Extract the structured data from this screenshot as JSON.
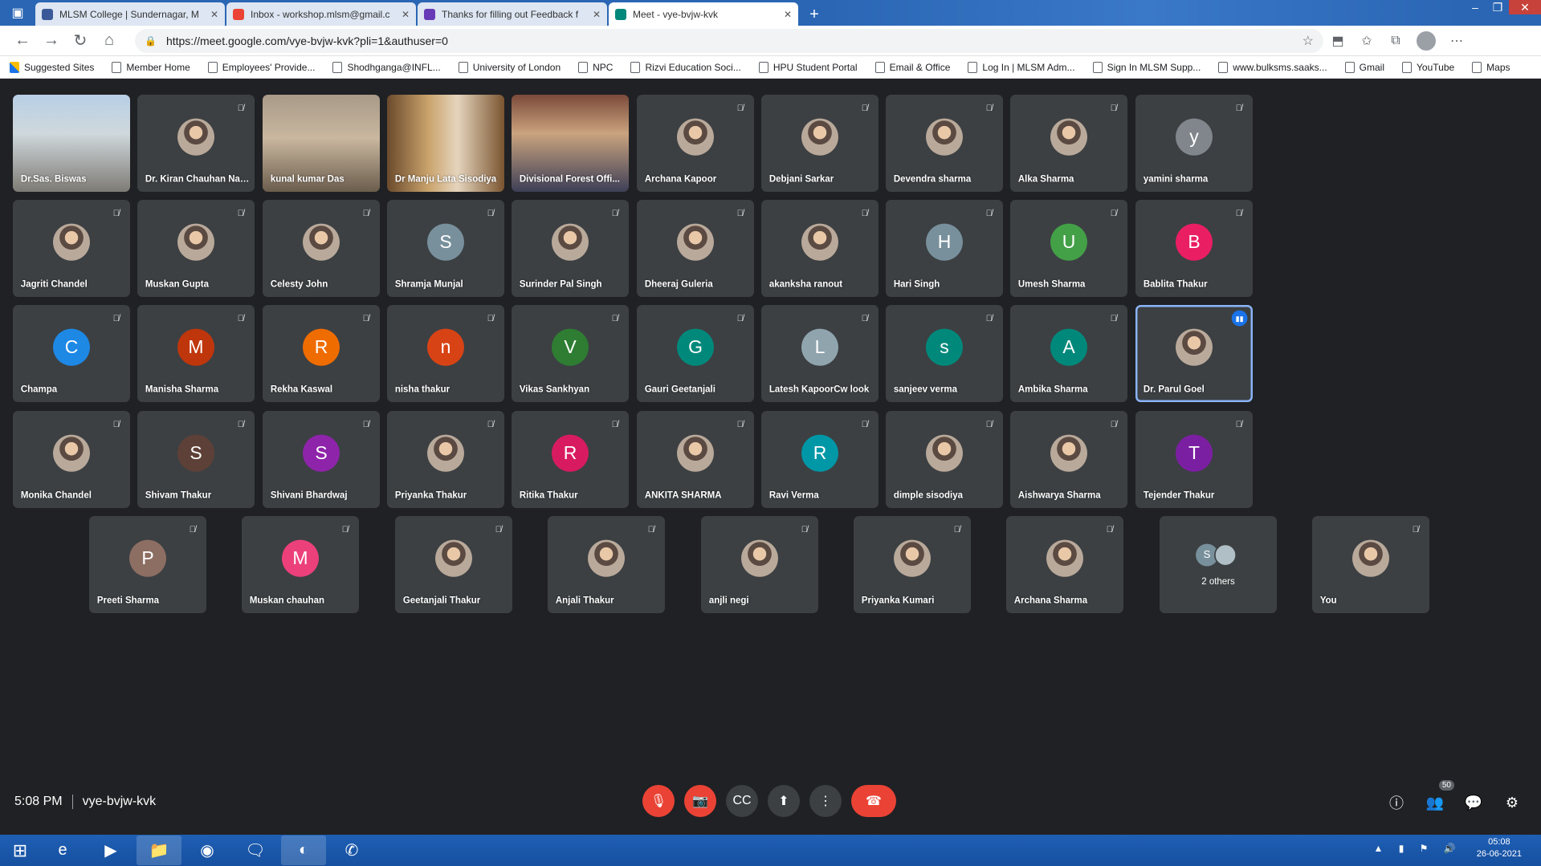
{
  "browser": {
    "tabs": [
      {
        "title": "MLSM College | Sundernagar, M",
        "favicon_color": "#3b5998",
        "active": false
      },
      {
        "title": "Inbox - workshop.mlsm@gmail.c",
        "favicon_color": "#ea4335",
        "active": false
      },
      {
        "title": "Thanks for filling out Feedback f",
        "favicon_color": "#673ab7",
        "active": false
      },
      {
        "title": "Meet - vye-bvjw-kvk",
        "favicon_color": "#00897b",
        "active": true
      }
    ],
    "url": "https://meet.google.com/vye-bvjw-kvk?pli=1&authuser=0",
    "bookmarks": [
      "Suggested Sites",
      "Member Home",
      "Employees' Provide...",
      "Shodhganga@INFL...",
      "University of London",
      "NPC",
      "Rizvi Education Soci...",
      "HPU Student Portal",
      "Email & Office",
      "Log In | MLSM Adm...",
      "Sign In MLSM Supp...",
      "www.bulksms.saaks...",
      "Gmail",
      "YouTube",
      "Maps"
    ]
  },
  "participants": [
    {
      "name": "Dr.Sas. Biswas",
      "video": "v1",
      "muted": false
    },
    {
      "name": "Dr. Kiran Chauhan Nar...",
      "photo": true,
      "muted": true
    },
    {
      "name": "kunal kumar Das",
      "video": "v2",
      "muted": false
    },
    {
      "name": "Dr Manju Lata Sisodiya",
      "video": "v3",
      "muted": false
    },
    {
      "name": "Divisional Forest Offi...",
      "video": "v4",
      "muted": false
    },
    {
      "name": "Archana Kapoor",
      "photo": true,
      "muted": true
    },
    {
      "name": "Debjani Sarkar",
      "photo": true,
      "muted": true
    },
    {
      "name": "Devendra sharma",
      "photo": true,
      "muted": true
    },
    {
      "name": "Alka Sharma",
      "photo": true,
      "muted": true
    },
    {
      "name": "yamini sharma",
      "initial": "y",
      "color": "#80868b",
      "muted": true
    },
    {
      "name": "Jagriti Chandel",
      "photo": true,
      "muted": true
    },
    {
      "name": "Muskan Gupta",
      "photo": true,
      "muted": true
    },
    {
      "name": "Celesty John",
      "photo": true,
      "muted": true
    },
    {
      "name": "Shramja Munjal",
      "initial": "S",
      "color": "#78909c",
      "muted": true
    },
    {
      "name": "Surinder Pal Singh",
      "photo": true,
      "muted": true
    },
    {
      "name": "Dheeraj Guleria",
      "photo": true,
      "muted": true
    },
    {
      "name": "akanksha ranout",
      "photo": true,
      "muted": true
    },
    {
      "name": "Hari Singh",
      "initial": "H",
      "color": "#78909c",
      "muted": true
    },
    {
      "name": "Umesh Sharma",
      "initial": "U",
      "color": "#43a047",
      "muted": true
    },
    {
      "name": "Bablita Thakur",
      "initial": "B",
      "color": "#e91e63",
      "muted": true
    },
    {
      "name": "Champa",
      "initial": "C",
      "color": "#1e88e5",
      "muted": true
    },
    {
      "name": "Manisha Sharma",
      "initial": "M",
      "color": "#bf360c",
      "muted": true
    },
    {
      "name": "Rekha Kaswal",
      "initial": "R",
      "color": "#ef6c00",
      "muted": true
    },
    {
      "name": "nisha thakur",
      "initial": "n",
      "color": "#d84315",
      "muted": true
    },
    {
      "name": "Vikas Sankhyan",
      "initial": "V",
      "color": "#2e7d32",
      "muted": true
    },
    {
      "name": "Gauri Geetanjali",
      "initial": "G",
      "color": "#00897b",
      "muted": true
    },
    {
      "name": "Latesh KapoorCw look",
      "initial": "L",
      "color": "#90a4ae",
      "muted": true
    },
    {
      "name": "sanjeev verma",
      "initial": "s",
      "color": "#00897b",
      "muted": true
    },
    {
      "name": "Ambika Sharma",
      "initial": "A",
      "color": "#00897b",
      "muted": true
    },
    {
      "name": "Dr. Parul Goel",
      "photo": true,
      "muted": false,
      "speaking": true
    },
    {
      "name": "Monika Chandel",
      "photo": true,
      "muted": true
    },
    {
      "name": "Shivam Thakur",
      "initial": "S",
      "color": "#5d4037",
      "muted": true
    },
    {
      "name": "Shivani Bhardwaj",
      "initial": "S",
      "color": "#8e24aa",
      "muted": true
    },
    {
      "name": "Priyanka Thakur",
      "photo": true,
      "muted": true
    },
    {
      "name": "Ritika Thakur",
      "initial": "R",
      "color": "#d81b60",
      "muted": true
    },
    {
      "name": "ANKITA SHARMA",
      "photo": true,
      "muted": true
    },
    {
      "name": "Ravi Verma",
      "initial": "R",
      "color": "#0097a7",
      "muted": true
    },
    {
      "name": "dimple sisodiya",
      "photo": true,
      "muted": true
    },
    {
      "name": "Aishwarya Sharma",
      "photo": true,
      "muted": true
    },
    {
      "name": "Tejender Thakur",
      "initial": "T",
      "color": "#7b1fa2",
      "muted": true
    },
    {
      "name": "Preeti Sharma",
      "initial": "P",
      "color": "#8d6e63",
      "muted": true
    },
    {
      "name": "Muskan chauhan",
      "initial": "M",
      "color": "#ec407a",
      "muted": true
    },
    {
      "name": "Geetanjali Thakur",
      "photo": true,
      "muted": true
    },
    {
      "name": "Anjali Thakur",
      "photo": true,
      "muted": true
    },
    {
      "name": "anjli negi",
      "photo": true,
      "muted": true
    },
    {
      "name": "Priyanka Kumari",
      "photo": true,
      "muted": true
    },
    {
      "name": "Archana Sharma",
      "photo": true,
      "muted": true
    },
    {
      "name": "2 others",
      "others": true,
      "initial": "S",
      "color": "#78909c",
      "muted": false
    },
    {
      "name": "You",
      "photo": true,
      "self": true,
      "muted": true
    }
  ],
  "meeting": {
    "time": "5:08 PM",
    "code": "vye-bvjw-kvk",
    "participant_count": "50"
  },
  "taskbar": {
    "time": "05:08",
    "date": "26-06-2021"
  }
}
